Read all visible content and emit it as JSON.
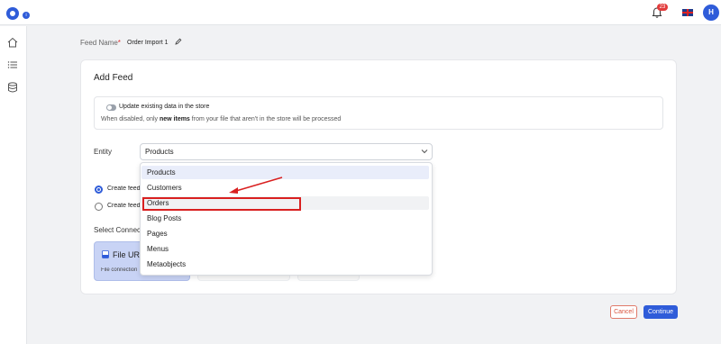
{
  "topbar": {
    "notification_count": "23",
    "avatar_initial": "H",
    "logo_badge": "i"
  },
  "sidebar": {
    "items": [
      {
        "icon": "home-icon"
      },
      {
        "icon": "list-icon"
      },
      {
        "icon": "database-icon"
      }
    ]
  },
  "feed": {
    "name_label": "Feed Name",
    "required_mark": "*",
    "name_value": "Order Import 1"
  },
  "card": {
    "title": "Add Feed",
    "toggle_label": "Update existing data in the store",
    "help_prefix": "When disabled, only ",
    "help_bold": "new items",
    "help_suffix": " from your file that aren't in the store will be processed",
    "entity_label": "Entity",
    "entity_value": "Products",
    "radio1_label": "Create feed",
    "radio2_label": "Create feed",
    "connect_label": "Select Connection",
    "tile_title": "File URL",
    "tile_sub": "File connection"
  },
  "dropdown": {
    "options": [
      "Products",
      "Customers",
      "Orders",
      "Blog Posts",
      "Pages",
      "Menus",
      "Metaobjects"
    ],
    "selected": "Products",
    "highlighted": "Orders"
  },
  "actions": {
    "cancel": "Cancel",
    "continue": "Continue"
  },
  "colors": {
    "accent": "#2f5cd9",
    "annotation": "#d92020",
    "cancel": "#d9553f"
  }
}
